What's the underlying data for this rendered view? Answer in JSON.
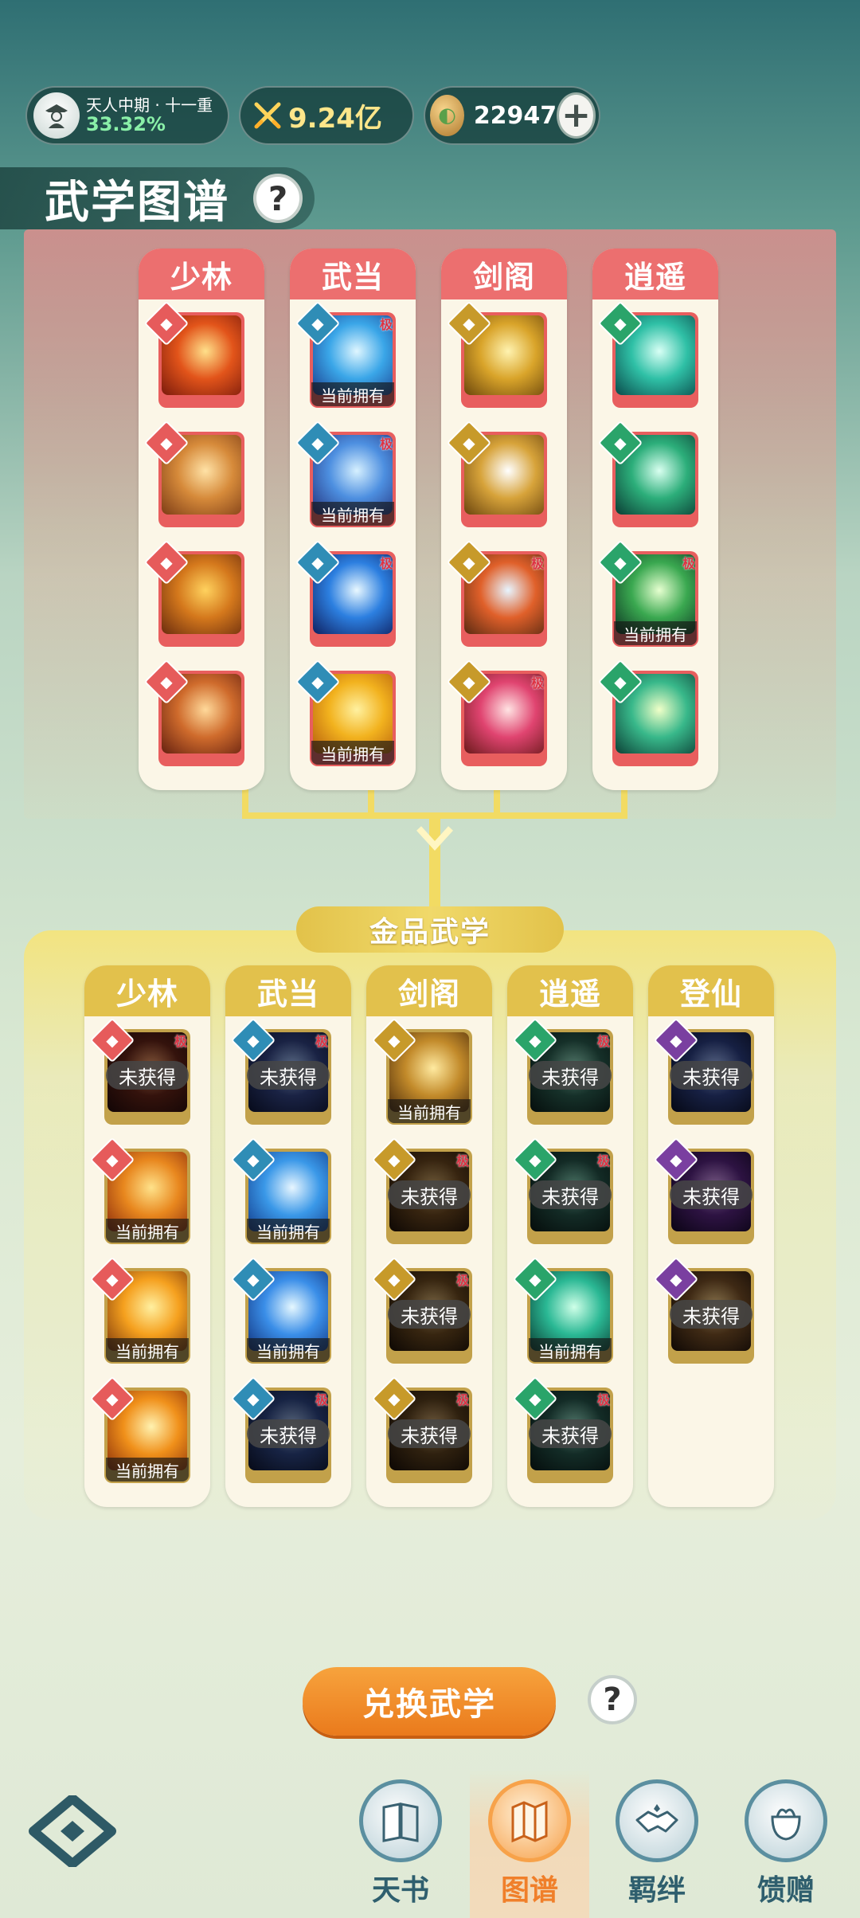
{
  "status": {
    "rank_title": "天人中期 · 十一重",
    "rank_percent": "33.32%",
    "power": "9.24亿",
    "currency": "22947",
    "plus": "+"
  },
  "header": {
    "title": "武学图谱",
    "help": "?"
  },
  "tiers": [
    {
      "name": "",
      "columns": [
        {
          "sect": "少林",
          "items": [
            {
              "own": "",
              "ji": "",
              "icon": "fire-strike-icon"
            },
            {
              "own": "",
              "ji": "",
              "icon": "meditation-icon"
            },
            {
              "own": "",
              "ji": "",
              "icon": "lion-icon"
            },
            {
              "own": "",
              "ji": "",
              "icon": "palms-icon"
            }
          ]
        },
        {
          "sect": "武当",
          "items": [
            {
              "own": "当前拥有",
              "ji": "极",
              "icon": "ice-burst-icon"
            },
            {
              "own": "当前拥有",
              "ji": "极",
              "icon": "sword-array-icon"
            },
            {
              "own": "",
              "ji": "极",
              "icon": "lightning-icon"
            },
            {
              "own": "当前拥有",
              "ji": "",
              "icon": "phoenix-icon"
            }
          ]
        },
        {
          "sect": "剑阁",
          "items": [
            {
              "own": "",
              "ji": "",
              "icon": "golden-swords-icon"
            },
            {
              "own": "",
              "ji": "",
              "icon": "sword-dancers-icon"
            },
            {
              "own": "",
              "ji": "极",
              "icon": "comet-icon"
            },
            {
              "own": "",
              "ji": "极",
              "icon": "crimson-blade-icon"
            }
          ]
        },
        {
          "sect": "逍遥",
          "items": [
            {
              "own": "",
              "ji": "",
              "icon": "jade-barrier-icon"
            },
            {
              "own": "",
              "ji": "",
              "icon": "jade-fan-icon"
            },
            {
              "own": "当前拥有",
              "ji": "极",
              "icon": "jade-claw-icon"
            },
            {
              "own": "",
              "ji": "",
              "icon": "jade-vortex-icon"
            }
          ]
        }
      ]
    },
    {
      "name": "金品武学",
      "columns": [
        {
          "sect": "少林",
          "items": [
            {
              "own": "未获得",
              "ji": "极",
              "icon": "flame-statue-icon"
            },
            {
              "own": "当前拥有",
              "ji": "",
              "icon": "golden-buddha-icon"
            },
            {
              "own": "当前拥有",
              "ji": "",
              "icon": "lotus-icon"
            },
            {
              "own": "当前拥有",
              "ji": "",
              "icon": "golden-orb-icon"
            }
          ]
        },
        {
          "sect": "武当",
          "items": [
            {
              "own": "未获得",
              "ji": "极",
              "icon": "dragon-seal-icon"
            },
            {
              "own": "当前拥有",
              "ji": "",
              "icon": "cloud-palm-icon"
            },
            {
              "own": "当前拥有",
              "ji": "",
              "icon": "frost-lance-icon"
            },
            {
              "own": "未获得",
              "ji": "极",
              "icon": "scroll-icon"
            }
          ]
        },
        {
          "sect": "剑阁",
          "items": [
            {
              "own": "当前拥有",
              "ji": "",
              "icon": "sword-rain-icon"
            },
            {
              "own": "未获得",
              "ji": "极",
              "icon": "dark-blade-icon"
            },
            {
              "own": "未获得",
              "ji": "极",
              "icon": "twin-blades-icon"
            },
            {
              "own": "未获得",
              "ji": "极",
              "icon": "shadow-sword-icon"
            }
          ]
        },
        {
          "sect": "逍遥",
          "items": [
            {
              "own": "未获得",
              "ji": "极",
              "icon": "jade-dragon-icon"
            },
            {
              "own": "未获得",
              "ji": "极",
              "icon": "jade-wind-icon"
            },
            {
              "own": "当前拥有",
              "ji": "",
              "icon": "jade-wave-icon"
            },
            {
              "own": "未获得",
              "ji": "极",
              "icon": "jade-spiral-icon"
            }
          ]
        },
        {
          "sect": "登仙",
          "items": [
            {
              "own": "未获得",
              "ji": "",
              "icon": "storm-icon"
            },
            {
              "own": "未获得",
              "ji": "",
              "icon": "void-icon"
            },
            {
              "own": "未获得",
              "ji": "",
              "icon": "sun-burst-icon"
            }
          ]
        }
      ]
    }
  ],
  "actions": {
    "exchange": "兑换武学",
    "help": "?"
  },
  "nav": [
    {
      "label": "天书",
      "icon": "book-icon",
      "active": false
    },
    {
      "label": "图谱",
      "icon": "map-icon",
      "active": true
    },
    {
      "label": "羁绊",
      "icon": "handshake-icon",
      "active": false
    },
    {
      "label": "馈赠",
      "icon": "gift-icon",
      "active": false
    }
  ],
  "colors": {
    "sect": {
      "少林": "#e65b5b",
      "武当": "#2f8db6",
      "剑阁": "#c79a2a",
      "逍遥": "#2aa46a",
      "登仙": "#7a3fa0"
    },
    "art": {
      "fire-strike-icon": [
        "#ffe08a",
        "#e2541a",
        "#7a1a0c"
      ],
      "meditation-icon": [
        "#ffe2a6",
        "#d68a3a",
        "#7c3c16"
      ],
      "lion-icon": [
        "#ffd25e",
        "#d4781c",
        "#6a2c0e"
      ],
      "palms-icon": [
        "#ffd99a",
        "#cf6b2c",
        "#652010"
      ],
      "ice-burst-icon": [
        "#dff6ff",
        "#3aa6e8",
        "#1a3a8a"
      ],
      "sword-array-icon": [
        "#d6f0ff",
        "#4d8fe0",
        "#23307a"
      ],
      "lightning-icon": [
        "#e9f8ff",
        "#2c7fe0",
        "#0f2060"
      ],
      "phoenix-icon": [
        "#fff1a0",
        "#f2b21e",
        "#b25a0c"
      ],
      "golden-swords-icon": [
        "#fff3b0",
        "#d9a42a",
        "#6b460c"
      ],
      "sword-dancers-icon": [
        "#ffffff",
        "#d7a33a",
        "#6a440e"
      ],
      "comet-icon": [
        "#e7f5ff",
        "#e0602a",
        "#5a2a12"
      ],
      "crimson-blade-icon": [
        "#ffe3e3",
        "#e04470",
        "#6a1a1a"
      ],
      "jade-barrier-icon": [
        "#d8fff5",
        "#2fc0a6",
        "#0a4a4a"
      ],
      "jade-fan-icon": [
        "#d9fff0",
        "#2cae7a",
        "#0b3d34"
      ],
      "jade-claw-icon": [
        "#e6ffd0",
        "#3aa850",
        "#0c3222"
      ],
      "jade-vortex-icon": [
        "#f0ffc8",
        "#38b88a",
        "#0c4036"
      ],
      "flame-statue-icon": [
        "#ff9a5a",
        "#6a1e10",
        "#240808"
      ],
      "golden-buddha-icon": [
        "#ffe28a",
        "#e8871e",
        "#8a2a0c"
      ],
      "lotus-icon": [
        "#fff0a0",
        "#f5a01e",
        "#7a360c"
      ],
      "golden-orb-icon": [
        "#fff2b0",
        "#f0901a",
        "#8a2e0a"
      ],
      "dragon-seal-icon": [
        "#9fc4ff",
        "#2a3e8a",
        "#0a1236"
      ],
      "cloud-palm-icon": [
        "#e8f6ff",
        "#3a98e8",
        "#123a8a"
      ],
      "frost-lance-icon": [
        "#e6f8ff",
        "#3a8ee8",
        "#10307a"
      ],
      "scroll-icon": [
        "#9ab8e8",
        "#24408a",
        "#0a1230"
      ],
      "sword-rain-icon": [
        "#ffeaa0",
        "#c28a2a",
        "#4a2a0a"
      ],
      "dark-blade-icon": [
        "#d2a45a",
        "#6a4012",
        "#1c0e04"
      ],
      "twin-blades-icon": [
        "#e0b46a",
        "#6a4212",
        "#1a0e04"
      ],
      "shadow-sword-icon": [
        "#cfa060",
        "#5a3a12",
        "#180c04"
      ],
      "jade-dragon-icon": [
        "#8ae0c0",
        "#1e5a4a",
        "#061a16"
      ],
      "jade-wind-icon": [
        "#7ad6b6",
        "#1a5044",
        "#061814"
      ],
      "jade-wave-icon": [
        "#cfffe8",
        "#2ab894",
        "#0a3a30"
      ],
      "jade-spiral-icon": [
        "#86dcc0",
        "#1a5246",
        "#061816"
      ],
      "storm-icon": [
        "#9ab8ff",
        "#243a8a",
        "#080e2a"
      ],
      "void-icon": [
        "#e2a0ff",
        "#5a1e8a",
        "#14062a"
      ],
      "sun-burst-icon": [
        "#ffcf7a",
        "#7a4a1a",
        "#1e0e06"
      ]
    }
  }
}
